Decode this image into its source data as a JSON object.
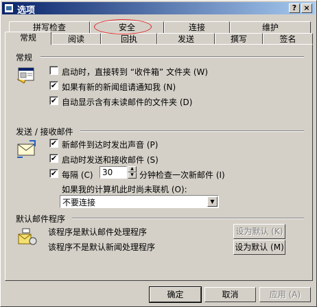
{
  "window": {
    "title": "选项",
    "help_btn": "?",
    "close_btn": "×"
  },
  "tabs_back": [
    "拼写检查",
    "安全",
    "连接",
    "维护"
  ],
  "tabs_front": [
    "常规",
    "阅读",
    "回执",
    "发送",
    "撰写",
    "签名"
  ],
  "general": {
    "header": "常规",
    "items": [
      {
        "label": "启动时，直接转到 “收件箱” 文件夹 (W)",
        "checked": false
      },
      {
        "label": "如果有新的新闻组请通知我 (N)",
        "checked": true
      },
      {
        "label": "自动显示含有未读邮件的文件夹 (D)",
        "checked": true
      }
    ]
  },
  "send_receive": {
    "header": "发送 / 接收邮件",
    "items": [
      {
        "label": "新邮件到达时发出声音 (P)",
        "checked": true
      },
      {
        "label": "启动时发送和接收邮件 (S)",
        "checked": true
      }
    ],
    "interval_label": "每隔 (C)",
    "interval_value": "30",
    "interval_suffix": "分钟检查一次新邮件 (I)",
    "offline_label": "如果我的计算机此时尚未联机 (O):",
    "offline_value": "不要连接"
  },
  "default_programs": {
    "header": "默认邮件程序",
    "mail_text": "该程序是默认邮件处理程序",
    "news_text": "该程序不是默认新闻处理程序",
    "mail_btn": "设为默认 (K)",
    "news_btn": "设为默认 (M)"
  },
  "footer": {
    "ok": "确定",
    "cancel": "取消",
    "apply": "应用 (A)"
  },
  "checkmark": "✔"
}
